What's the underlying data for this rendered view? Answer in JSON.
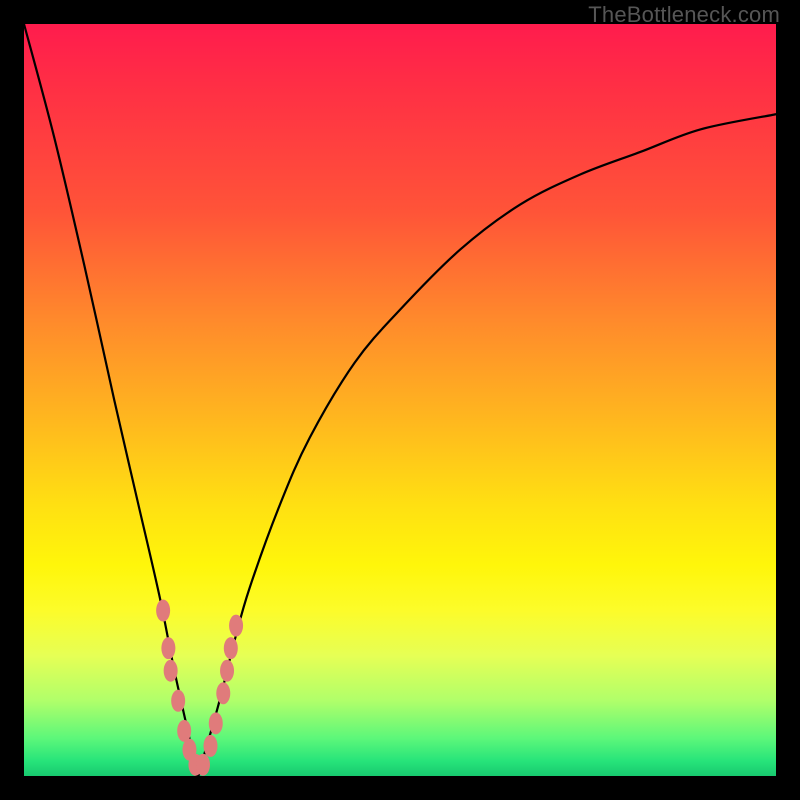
{
  "watermark": "TheBottleneck.com",
  "colors": {
    "gradient_top": "#ff1c4d",
    "gradient_mid1": "#ffb51f",
    "gradient_mid2": "#fff60a",
    "gradient_bottom": "#18c96f",
    "curve": "#000000",
    "marker": "#e07b7b",
    "frame": "#000000"
  },
  "chart_data": {
    "type": "line",
    "title": "",
    "xlabel": "",
    "ylabel": "",
    "xlim": [
      0,
      100
    ],
    "ylim": [
      0,
      100
    ],
    "notes": "V-shaped bottleneck curve. y≈100 at left edge, dips to ~0 around x≈23, rises asymptotically toward ~88 on the right. Pink capsule markers cluster on both branches near the valley between y≈2 and y≈22.",
    "series": [
      {
        "name": "bottleneck-curve",
        "x": [
          0,
          4,
          8,
          12,
          15,
          18,
          20,
          22,
          23,
          24,
          26,
          28,
          30,
          34,
          38,
          44,
          50,
          58,
          66,
          74,
          82,
          90,
          100
        ],
        "y": [
          100,
          85,
          68,
          50,
          37,
          24,
          14,
          5,
          0,
          3,
          10,
          18,
          25,
          36,
          45,
          55,
          62,
          70,
          76,
          80,
          83,
          86,
          88
        ]
      }
    ],
    "markers": {
      "name": "highlighted-points",
      "comment": "Pink rounded markers clustered near the valley on both branches",
      "points": [
        {
          "x": 18.5,
          "y": 22
        },
        {
          "x": 19.2,
          "y": 17
        },
        {
          "x": 19.5,
          "y": 14
        },
        {
          "x": 20.5,
          "y": 10
        },
        {
          "x": 21.3,
          "y": 6
        },
        {
          "x": 22.0,
          "y": 3.5
        },
        {
          "x": 22.8,
          "y": 1.5
        },
        {
          "x": 23.8,
          "y": 1.5
        },
        {
          "x": 24.8,
          "y": 4
        },
        {
          "x": 25.5,
          "y": 7
        },
        {
          "x": 26.5,
          "y": 11
        },
        {
          "x": 27.0,
          "y": 14
        },
        {
          "x": 27.5,
          "y": 17
        },
        {
          "x": 28.2,
          "y": 20
        }
      ]
    }
  }
}
